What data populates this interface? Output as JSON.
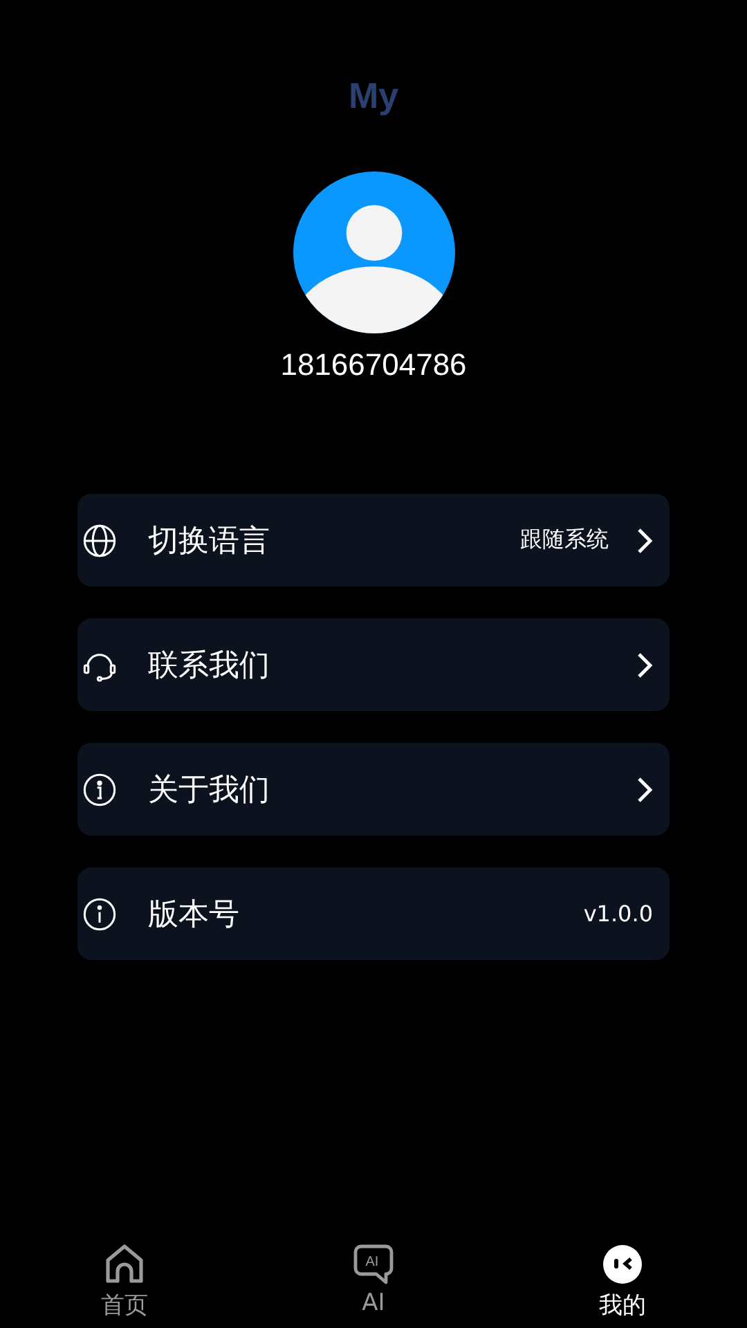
{
  "header": {
    "title": "My"
  },
  "profile": {
    "phone": "18166704786"
  },
  "menu": [
    {
      "kind": "language",
      "label": "切换语言",
      "value": "跟随系统",
      "arrow": true
    },
    {
      "kind": "contact",
      "label": "联系我们",
      "arrow": true
    },
    {
      "kind": "about",
      "label": "关于我们",
      "arrow": true
    },
    {
      "kind": "version",
      "label": "版本号",
      "value": "v1.0.0",
      "arrow": false
    }
  ],
  "tabs": [
    {
      "kind": "home",
      "label": "首页",
      "selected": false
    },
    {
      "kind": "ai",
      "label": "AI",
      "icon_text": "AI",
      "selected": false
    },
    {
      "kind": "me",
      "label": "我的",
      "selected": true
    }
  ]
}
